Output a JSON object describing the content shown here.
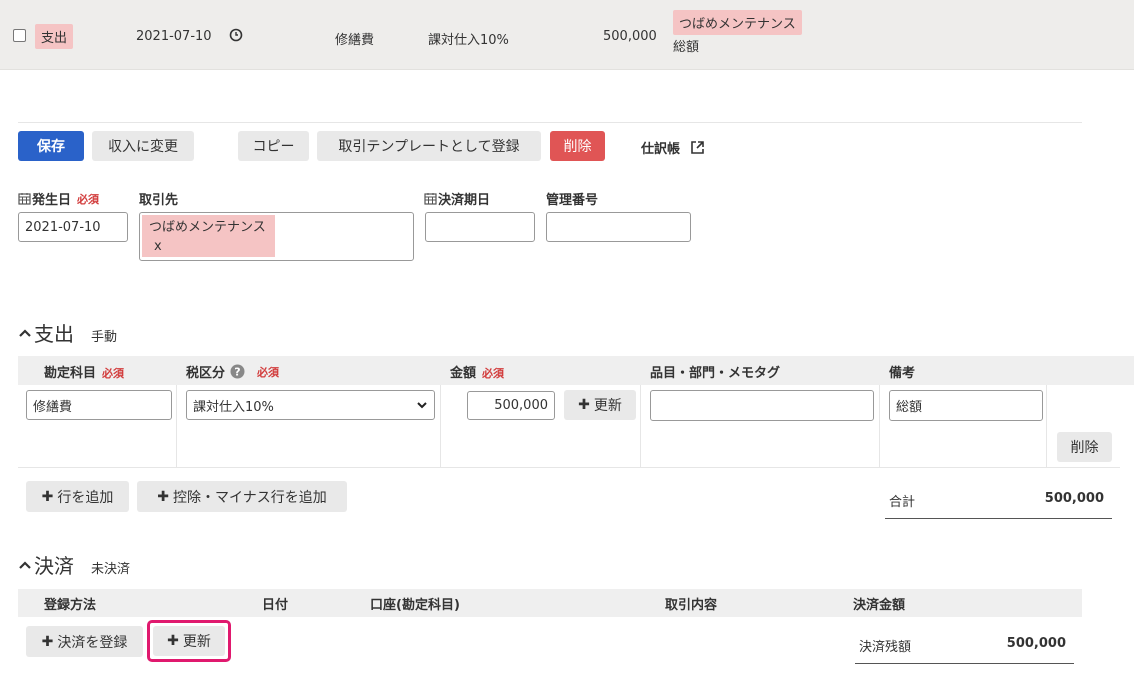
{
  "row": {
    "type": "支出",
    "date": "2021-07-10",
    "account": "修繕費",
    "tax": "課対仕入10%",
    "amount": "500,000",
    "partner": "つばめメンテナンス",
    "note": "総額"
  },
  "toolbar": {
    "save": "保存",
    "change_income": "収入に変更",
    "copy": "コピー",
    "register_template": "取引テンプレートとして登録",
    "delete": "削除",
    "journal": "仕訳帳"
  },
  "form": {
    "date_label": "発生日",
    "required": "必須",
    "date_value": "2021-07-10",
    "partner_label": "取引先",
    "partner_value": "つばめメンテナンス",
    "partner_remove": "x",
    "due_label": "決済期日",
    "due_value": "",
    "mgmt_label": "管理番号",
    "mgmt_value": ""
  },
  "expense": {
    "title": "支出",
    "mode": "手動",
    "headers": {
      "account": "勘定科目",
      "tax": "税区分",
      "amount": "金額",
      "item": "品目・部門・メモタグ",
      "memo": "備考"
    },
    "line": {
      "account": "修繕費",
      "tax": "課対仕入10%",
      "amount": "500,000",
      "update": "更新",
      "item": "",
      "memo": "総額",
      "delete": "削除"
    },
    "add_row": "行を追加",
    "add_deduction": "控除・マイナス行を追加",
    "total_label": "合計",
    "total_value": "500,000"
  },
  "settlement": {
    "title": "決済",
    "status": "未決済",
    "headers": {
      "method": "登録方法",
      "date": "日付",
      "account": "口座(勘定科目)",
      "description": "取引内容",
      "amount": "決済金額"
    },
    "register": "決済を登録",
    "update": "更新",
    "balance_label": "決済残額",
    "balance_value": "500,000"
  },
  "colors": {
    "primary": "#2a62c9",
    "danger": "#e05555",
    "tag": "#f5c4c4",
    "highlight": "#e0196e"
  }
}
